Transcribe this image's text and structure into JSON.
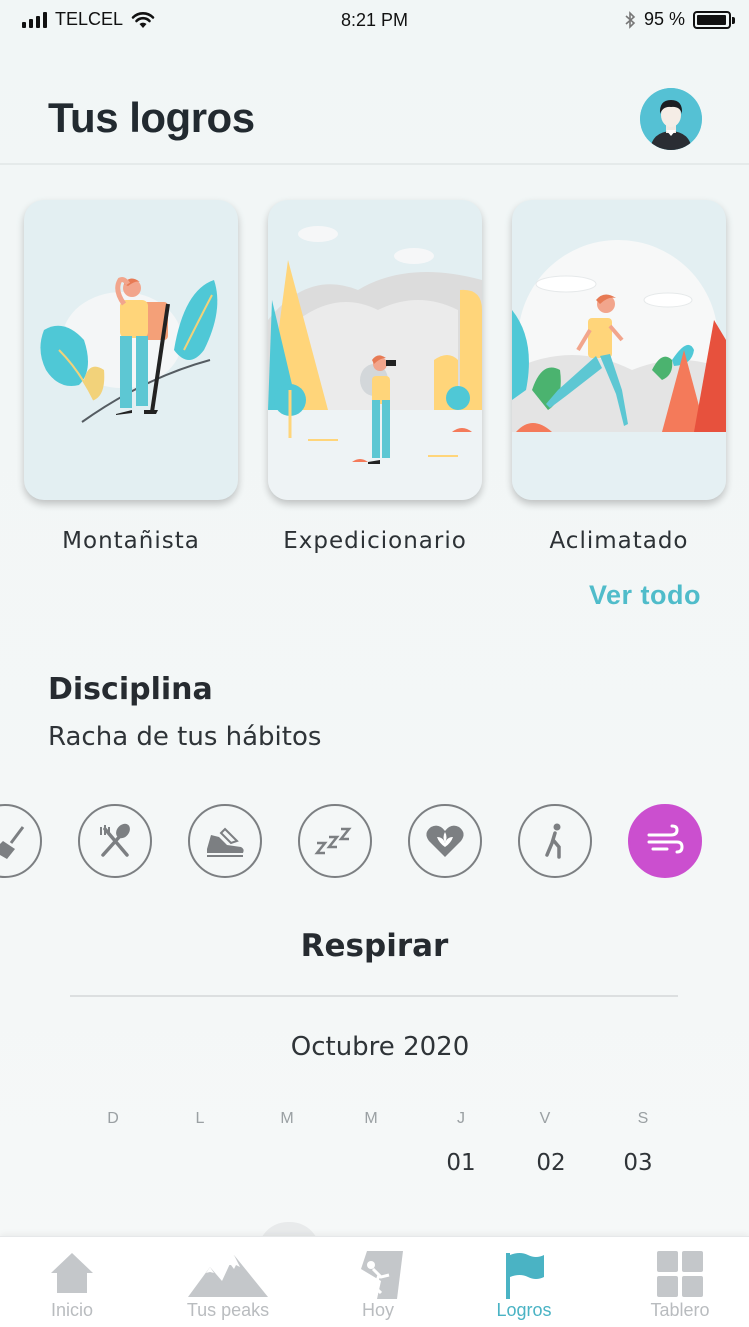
{
  "status_bar": {
    "carrier": "TELCEL",
    "time": "8:21 PM",
    "battery_text": "95 %",
    "battery_level": 0.95
  },
  "header": {
    "title": "Tus logros",
    "avatar_icon": "user-avatar-icon"
  },
  "achievements": {
    "cards": [
      {
        "label": "Montañista",
        "illustration": "hiker-waving-illustration"
      },
      {
        "label": "Expedicionario",
        "illustration": "explorer-binoculars-illustration"
      },
      {
        "label": "Aclimatado",
        "illustration": "runner-illustration"
      }
    ],
    "see_all_label": "Ver todo"
  },
  "discipline": {
    "title": "Disciplina",
    "subtitle": "Racha de tus hábitos",
    "habits": [
      {
        "icon": "broom-icon",
        "active": false
      },
      {
        "icon": "fork-spoon-icon",
        "active": false
      },
      {
        "icon": "sneaker-icon",
        "active": false
      },
      {
        "icon": "sleep-zzz-icon",
        "active": false
      },
      {
        "icon": "heart-lotus-icon",
        "active": false
      },
      {
        "icon": "walking-person-icon",
        "active": false
      },
      {
        "icon": "wind-icon",
        "active": true
      }
    ],
    "selected_habit": "Respirar",
    "accent_color": "#cb4fcf"
  },
  "calendar": {
    "month": "Octubre 2020",
    "weekdays": [
      "D",
      "L",
      "M",
      "M",
      "J",
      "V",
      "S"
    ],
    "days": [
      "01",
      "02",
      "03"
    ]
  },
  "bottom_nav": {
    "items": [
      {
        "label": "Inicio",
        "icon": "home-icon",
        "active": false
      },
      {
        "label": "Tus peaks",
        "icon": "mountains-icon",
        "active": false
      },
      {
        "label": "Hoy",
        "icon": "climber-icon",
        "active": false
      },
      {
        "label": "Logros",
        "icon": "flag-icon",
        "active": true
      },
      {
        "label": "Tablero",
        "icon": "grid-icon",
        "active": false
      }
    ],
    "active_color": "#4ab3c4",
    "inactive_color": "#b9bcbf"
  }
}
